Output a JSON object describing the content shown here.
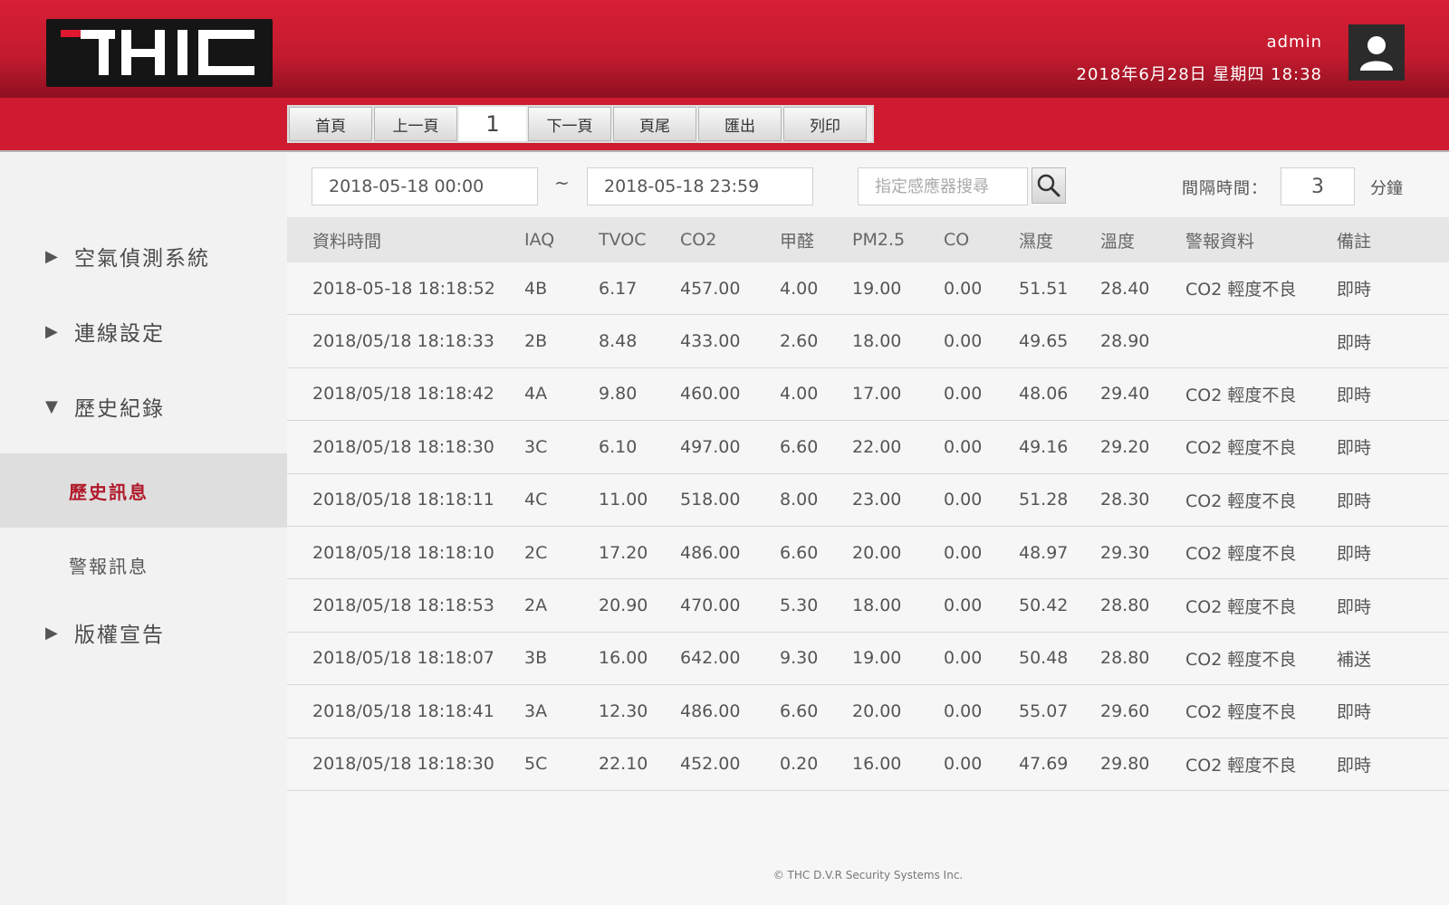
{
  "header": {
    "user": "admin",
    "datetime": "2018年6月28日 星期四 18:38",
    "logo_text": "THC",
    "colors": {
      "primary_red": "#cf1a30",
      "logo_bg": "#151515"
    }
  },
  "pager": {
    "first": "首頁",
    "prev": "上一頁",
    "current_page": "1",
    "next": "下一頁",
    "last": "頁尾",
    "export": "匯出",
    "print": "列印"
  },
  "sidebar": {
    "items": [
      {
        "label": "空氣偵測系統",
        "arrow": "▶"
      },
      {
        "label": "連線設定",
        "arrow": "▶"
      },
      {
        "label": "歷史紀錄",
        "arrow": "▼"
      },
      {
        "label": "版權宣告",
        "arrow": "▶"
      }
    ],
    "sub_items": [
      {
        "label": "歷史訊息",
        "active": true
      },
      {
        "label": "警報訊息",
        "active": false
      }
    ]
  },
  "filters": {
    "start_time": "2018-05-18 00:00",
    "separator": "~",
    "end_time": "2018-05-18 23:59",
    "search_placeholder": "指定感應器搜尋",
    "interval_label": "間隔時間：",
    "interval_value": "3",
    "interval_unit": "分鐘"
  },
  "table": {
    "columns": [
      "資料時間",
      "IAQ",
      "TVOC",
      "CO2",
      "甲醛",
      "PM2.5",
      "CO",
      "濕度",
      "溫度",
      "警報資料",
      "備註"
    ],
    "rows": [
      [
        "2018-05-18  18:18:52",
        "4B",
        "6.17",
        "457.00",
        "4.00",
        "19.00",
        "0.00",
        "51.51",
        "28.40",
        "CO2 輕度不良",
        "即時"
      ],
      [
        "2018/05/18  18:18:33",
        "2B",
        "8.48",
        "433.00",
        "2.60",
        "18.00",
        "0.00",
        "49.65",
        "28.90",
        "",
        "即時"
      ],
      [
        "2018/05/18  18:18:42",
        "4A",
        "9.80",
        "460.00",
        "4.00",
        "17.00",
        "0.00",
        "48.06",
        "29.40",
        "CO2 輕度不良",
        "即時"
      ],
      [
        "2018/05/18  18:18:30",
        "3C",
        "6.10",
        "497.00",
        "6.60",
        "22.00",
        "0.00",
        "49.16",
        "29.20",
        "CO2 輕度不良",
        "即時"
      ],
      [
        "2018/05/18  18:18:11",
        "4C",
        "11.00",
        "518.00",
        "8.00",
        "23.00",
        "0.00",
        "51.28",
        "28.30",
        "CO2 輕度不良",
        "即時"
      ],
      [
        "2018/05/18  18:18:10",
        "2C",
        "17.20",
        "486.00",
        "6.60",
        "20.00",
        "0.00",
        "48.97",
        "29.30",
        "CO2 輕度不良",
        "即時"
      ],
      [
        "2018/05/18  18:18:53",
        "2A",
        "20.90",
        "470.00",
        "5.30",
        "18.00",
        "0.00",
        "50.42",
        "28.80",
        "CO2 輕度不良",
        "即時"
      ],
      [
        "2018/05/18  18:18:07",
        "3B",
        "16.00",
        "642.00",
        "9.30",
        "19.00",
        "0.00",
        "50.48",
        "28.80",
        "CO2 輕度不良",
        "補送"
      ],
      [
        "2018/05/18  18:18:41",
        "3A",
        "12.30",
        "486.00",
        "6.60",
        "20.00",
        "0.00",
        "55.07",
        "29.60",
        "CO2 輕度不良",
        "即時"
      ],
      [
        "2018/05/18  18:18:30",
        "5C",
        "22.10",
        "452.00",
        "0.20",
        "16.00",
        "0.00",
        "47.69",
        "29.80",
        "CO2 輕度不良",
        "即時"
      ]
    ]
  },
  "footer": {
    "copyright": "© THC D.V.R Security Systems Inc."
  }
}
